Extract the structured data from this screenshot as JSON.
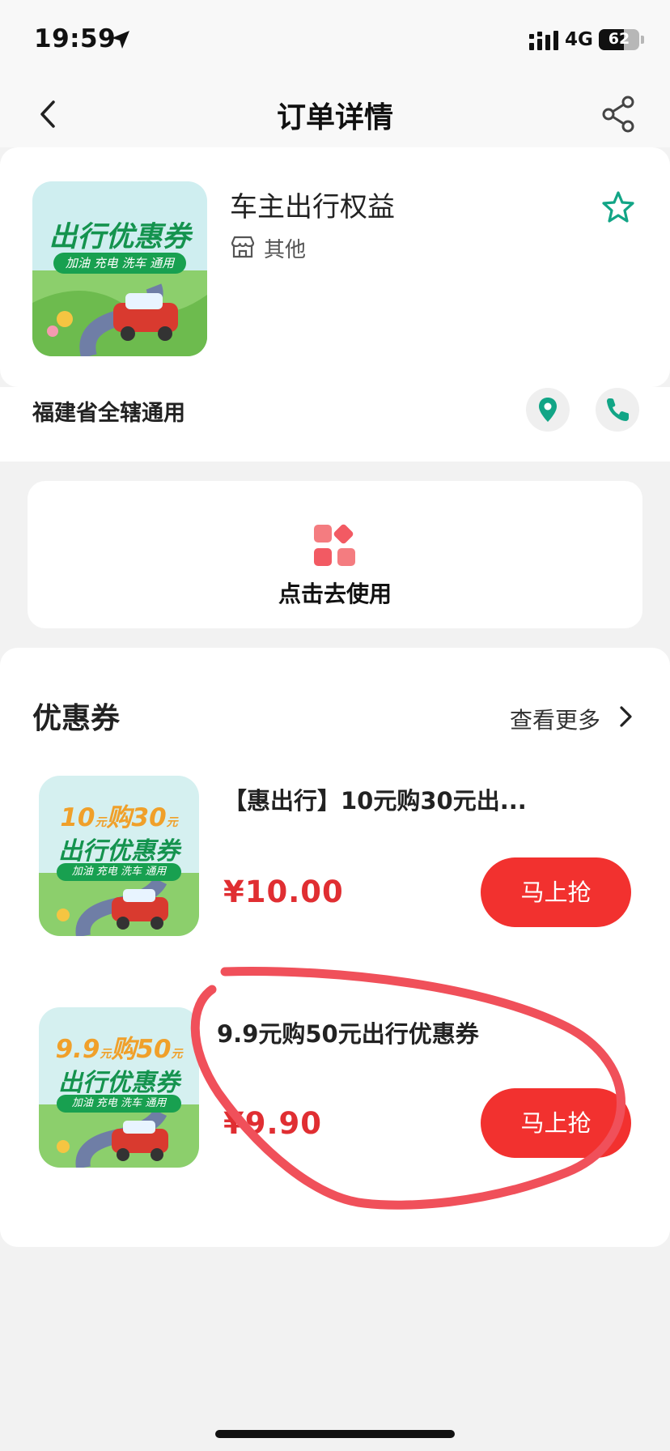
{
  "status_bar": {
    "time": "19:59",
    "network": "4G",
    "battery": "62",
    "battery_level": 0.62,
    "icons": [
      "location-arrow-icon",
      "signal-icon",
      "battery-icon"
    ]
  },
  "nav": {
    "title": "订单详情",
    "icons": [
      "back-chevron-icon",
      "share-icon"
    ]
  },
  "merchant": {
    "name": "车主出行权益",
    "category": "其他",
    "region": "福建省全辖通用",
    "image": {
      "title": "出行优惠券",
      "tag": "加油 充电 洗车 通用"
    },
    "icons": [
      "shop-icon",
      "star-icon",
      "location-pin-icon",
      "phone-icon"
    ]
  },
  "use_action": {
    "label": "点击去使用",
    "icon": "apps-grid-icon"
  },
  "coupons_section": {
    "title": "优惠券",
    "more_label": "查看更多",
    "items": [
      {
        "title": "【惠出行】10元购30元出...",
        "price": "¥10.00",
        "button": "马上抢",
        "image": {
          "promo_a": "10",
          "promo_b": "购",
          "promo_c": "30",
          "unit": "元",
          "title": "出行优惠券",
          "tag": "加油 充电 洗车 通用"
        }
      },
      {
        "title": "9.9元购50元出行优惠券",
        "price": "¥9.90",
        "button": "马上抢",
        "image": {
          "promo_a": "9.9",
          "promo_b": "购",
          "promo_c": "50",
          "unit": "元",
          "title": "出行优惠券",
          "tag": "加油 充电 洗车 通用"
        }
      }
    ]
  },
  "colors": {
    "brand_green": "#12a586",
    "price_red": "#e02e32",
    "button_red": "#f2312f",
    "annotation_red": "#f0505a"
  }
}
